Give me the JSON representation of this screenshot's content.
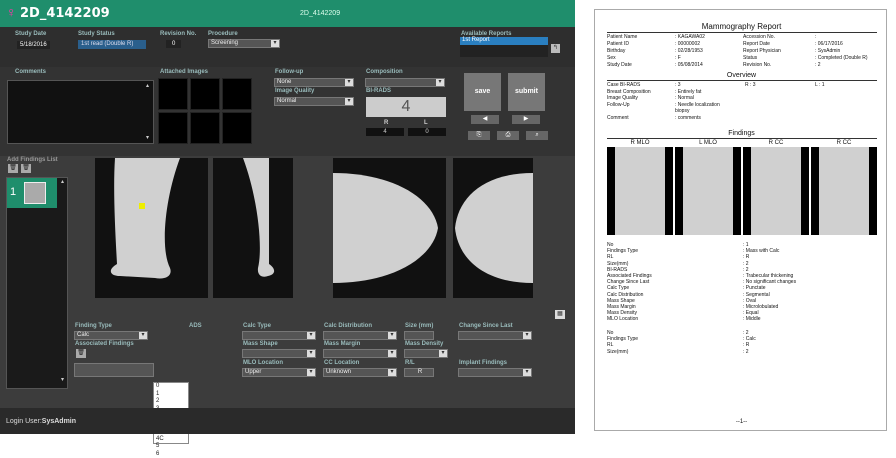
{
  "titlebar": {
    "gender_icon": "♀",
    "title": "2D_4142209",
    "center_title": "2D_4142209"
  },
  "study": {
    "date_label": "Study Date",
    "date": "5/18/2016",
    "status_label": "Study Status",
    "status": "1st read (Double R)",
    "revision_label": "Revision No.",
    "revision": "0",
    "procedure_label": "Procedure",
    "procedure": "Screening"
  },
  "reports": {
    "label": "Available Reports",
    "items": [
      "1st Report"
    ]
  },
  "sections": {
    "comments": "Comments",
    "attached": "Attached Images",
    "followup": "Follow-up",
    "followup_value": "None",
    "image_quality": "Image Quality",
    "image_quality_value": "Normal",
    "composition": "Composition",
    "birads": "BI-RADS",
    "birads_value": "4",
    "r_label": "R",
    "l_label": "L",
    "r_value": "4",
    "l_value": "0"
  },
  "buttons": {
    "save": "save",
    "submit": "submit",
    "prev": "◀",
    "next": "▶"
  },
  "findings_list": {
    "label": "Add Findings List",
    "item_number": "1"
  },
  "form": {
    "finding_type": "Finding Type",
    "finding_type_value": "Calc",
    "associated": "Associated Findings",
    "birads_hint": "ADS",
    "calc_type": "Calc Type",
    "calc_dist": "Calc Distribution",
    "size": "Size (mm)",
    "change": "Change Since Last",
    "mass_shape": "Mass Shape",
    "mass_margin": "Mass Margin",
    "mass_density": "Mass Density",
    "mlo_loc": "MLO Location",
    "mlo_loc_value": "Upper",
    "cc_loc": "CC Location",
    "cc_loc_value": "Unknown",
    "rl": "R/L",
    "rl_value": "R",
    "implant": "Implant Findings"
  },
  "dropdown_options": [
    "0",
    "1",
    "2",
    "3",
    "4",
    "4A",
    "4B",
    "4C",
    "5",
    "6"
  ],
  "dropdown_selected_index": 4,
  "footer": {
    "login_label": "Login User:",
    "user": "SysAdmin"
  },
  "report": {
    "title": "Mammography Report",
    "patient_rows": [
      [
        "Patient Name",
        ": KAGAWA02",
        "Accession No.",
        ":"
      ],
      [
        "Patient ID",
        ": 00000002",
        "Report Date",
        ": 06/17/2016"
      ],
      [
        "Birthday",
        ": 02/28/1953",
        "Report Physician",
        ": SysAdmin"
      ],
      [
        "Sex",
        ": F",
        "Status",
        ": Completed (Double R)"
      ],
      [
        "Study Date",
        ": 05/08/2014",
        "Revision No.",
        ": 2"
      ]
    ],
    "overview_title": "Overview",
    "overview_rows": [
      [
        "Case BI-RADS",
        ": 3",
        "R : 3",
        "L : 1"
      ],
      [
        "Breast Composition",
        ": Entirely fat",
        "",
        ""
      ],
      [
        "Image Quality",
        ": Normal",
        "",
        ""
      ],
      [
        "Follow-Up",
        ": Needle localization",
        "",
        ""
      ],
      [
        "",
        "  biopsy",
        "",
        ""
      ],
      [
        "Comment",
        ": comments",
        "",
        ""
      ]
    ],
    "findings_title": "Findings",
    "views": [
      "R MLO",
      "L MLO",
      "R CC",
      "R CC"
    ],
    "finding1": [
      [
        "No",
        ": 1"
      ],
      [
        "Findings Type",
        ": Mass with Calc"
      ],
      [
        "RL",
        ": R"
      ],
      [
        "Size(mm)",
        ": 2"
      ],
      [
        "BI-RADS",
        ": 2"
      ],
      [
        "Associated Findings",
        ": Trabecular thickening"
      ],
      [
        "Change Since Last",
        ": No significant changes"
      ],
      [
        "Calc Type",
        ": Punctate"
      ],
      [
        "Calc Distribution",
        ": Segmental"
      ],
      [
        "Mass Shape",
        ": Oval"
      ],
      [
        "Mass Margin",
        ": Microlobulated"
      ],
      [
        "Mass Density",
        ": Equal"
      ],
      [
        "MLO Location",
        ": Middle"
      ]
    ],
    "finding2": [
      [
        "No",
        ": 2"
      ],
      [
        "Findings Type",
        ": Calc"
      ],
      [
        "RL",
        ": R"
      ],
      [
        "Size(mm)",
        ": 2"
      ]
    ],
    "page": "--1--"
  }
}
